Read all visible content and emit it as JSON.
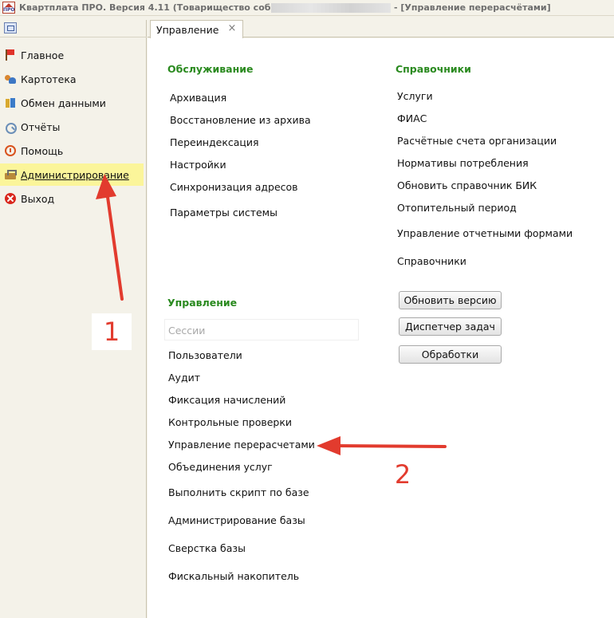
{
  "window": {
    "title": "Квартплата ПРО.  Версия 4.11 (Товарищество собственник",
    "title_suffix": "- [Управление перерасчётами]",
    "app_icon_text": "ПРО"
  },
  "sidebar": {
    "items": [
      {
        "label": "Главное",
        "icon": "flag-icon",
        "active": false
      },
      {
        "label": "Картотека",
        "icon": "people-icon",
        "active": false
      },
      {
        "label": "Обмен данными",
        "icon": "exchange-icon",
        "active": false
      },
      {
        "label": "Отчёты",
        "icon": "report-icon",
        "active": false
      },
      {
        "label": "Помощь",
        "icon": "help-icon",
        "active": false
      },
      {
        "label": "Администрирование",
        "icon": "admin-icon",
        "active": true
      },
      {
        "label": "Выход",
        "icon": "exit-icon",
        "active": false
      }
    ],
    "active_highlight_color": "#fbf59a"
  },
  "tabs": [
    {
      "label": "Управление",
      "close": "×"
    }
  ],
  "main": {
    "maintenance": {
      "title": "Обслуживание",
      "items": [
        "Архивация",
        "Восстановление из архива",
        "Переиндексация",
        "Настройки",
        "Синхронизация адресов",
        "Параметры системы"
      ]
    },
    "directories": {
      "title": "Справочники",
      "items": [
        "Услуги",
        "ФИАС",
        "Расчётные счета организации",
        "Нормативы потребления",
        "Обновить справочник БИК",
        "Отопительный период",
        "Управление отчетными формами",
        "Справочники"
      ]
    },
    "management": {
      "title": "Управление",
      "disabled_item": "Сессии",
      "items": [
        "Пользователи",
        "Аудит",
        "Фиксация начислений",
        "Контрольные проверки",
        "Управление перерасчетами",
        "Объединения услуг",
        "Выполнить скрипт по базе",
        "Администрирование базы",
        "Сверстка базы",
        "Фискальный накопитель"
      ]
    },
    "buttons": [
      "Обновить версию",
      "Диспетчер задач",
      "Обработки"
    ],
    "section_title_color": "#2a8a1f"
  },
  "annotations": [
    {
      "label": "1",
      "color": "#e23b2e"
    },
    {
      "label": "2",
      "color": "#e23b2e"
    }
  ]
}
